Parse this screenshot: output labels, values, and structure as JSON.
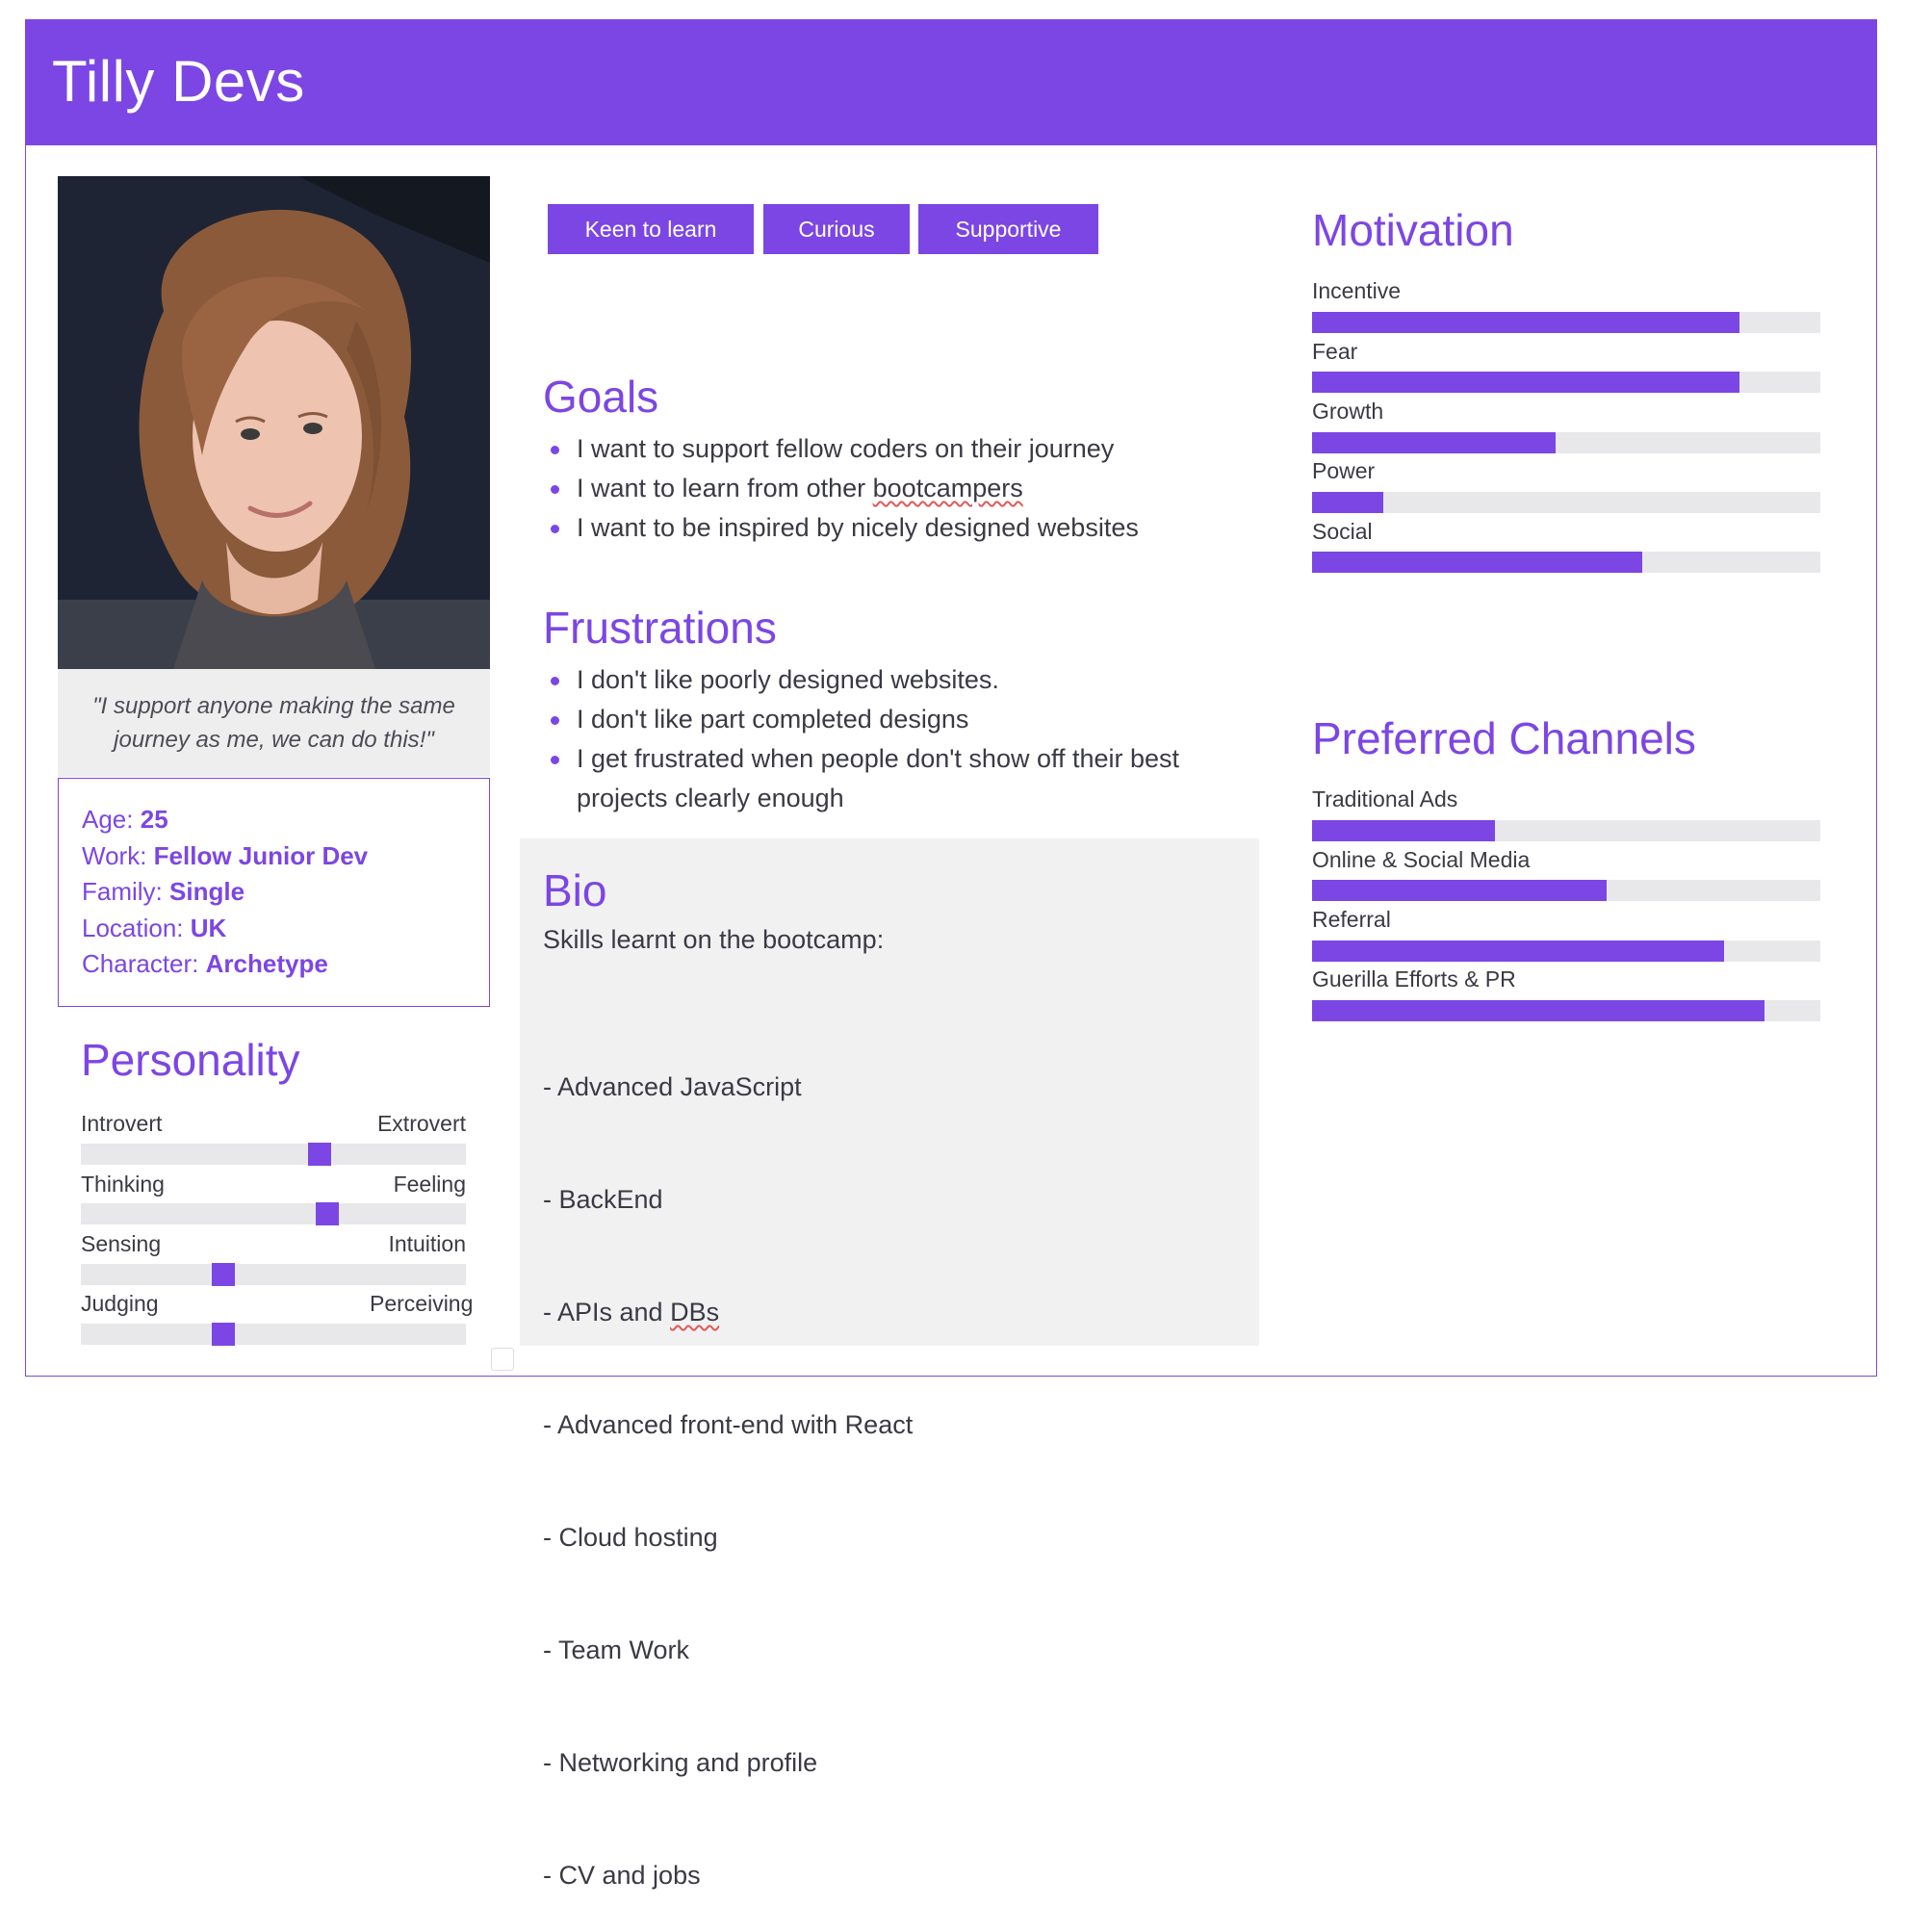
{
  "header": {
    "title": "Tilly Devs"
  },
  "profile": {
    "quote": "\"I support anyone making the same journey as me, we can do this!\"",
    "details": [
      {
        "label": "Age:",
        "value": "25"
      },
      {
        "label": "Work:",
        "value": "Fellow Junior Dev"
      },
      {
        "label": "Family:",
        "value": "Single"
      },
      {
        "label": "Location:",
        "value": "UK"
      },
      {
        "label": "Character:",
        "value": "Archetype"
      }
    ]
  },
  "personality": {
    "title": "Personality",
    "scales": [
      {
        "left": "Introvert",
        "right": "Extrovert",
        "position": 0.62
      },
      {
        "left": "Thinking",
        "right": "Feeling",
        "position": 0.64
      },
      {
        "left": "Sensing",
        "right": "Intuition",
        "position": 0.37
      },
      {
        "left": "Judging",
        "right": "Perceiving",
        "position": 0.37
      }
    ]
  },
  "tags": [
    "Keen to learn",
    "Curious",
    "Supportive"
  ],
  "goals": {
    "title": "Goals",
    "items": [
      "I want to support fellow coders on their journey",
      "I want to learn from other bootcampers",
      "I want to be inspired by nicely designed websites"
    ]
  },
  "frustrations": {
    "title": "Frustrations",
    "items": [
      "I don't like poorly designed websites.",
      "I don't like part completed designs",
      "I get frustrated when people don't show off their best projects clearly enough"
    ]
  },
  "bio": {
    "title": "Bio",
    "intro": "Skills learnt on the bootcamp:",
    "skills": [
      "- Advanced JavaScript",
      "- BackEnd",
      "- APIs and DBs",
      "- Advanced front-end with React",
      "- Cloud hosting",
      "- Team Work",
      "- Networking and profile",
      "- CV and jobs"
    ]
  },
  "motivation": {
    "title": "Motivation",
    "bars": [
      {
        "label": "Incentive",
        "value": 0.84
      },
      {
        "label": "Fear",
        "value": 0.84
      },
      {
        "label": "Growth",
        "value": 0.48
      },
      {
        "label": "Power",
        "value": 0.14
      },
      {
        "label": "Social",
        "value": 0.65
      }
    ]
  },
  "channels": {
    "title": "Preferred Channels",
    "bars": [
      {
        "label": "Traditional Ads",
        "value": 0.36
      },
      {
        "label": "Online & Social Media",
        "value": 0.58
      },
      {
        "label": "Referral",
        "value": 0.81
      },
      {
        "label": "Guerilla Efforts & PR",
        "value": 0.89
      }
    ]
  },
  "colors": {
    "accent": "#7c46e4",
    "track": "#e8e8ea",
    "panel": "#f1f1f2"
  }
}
